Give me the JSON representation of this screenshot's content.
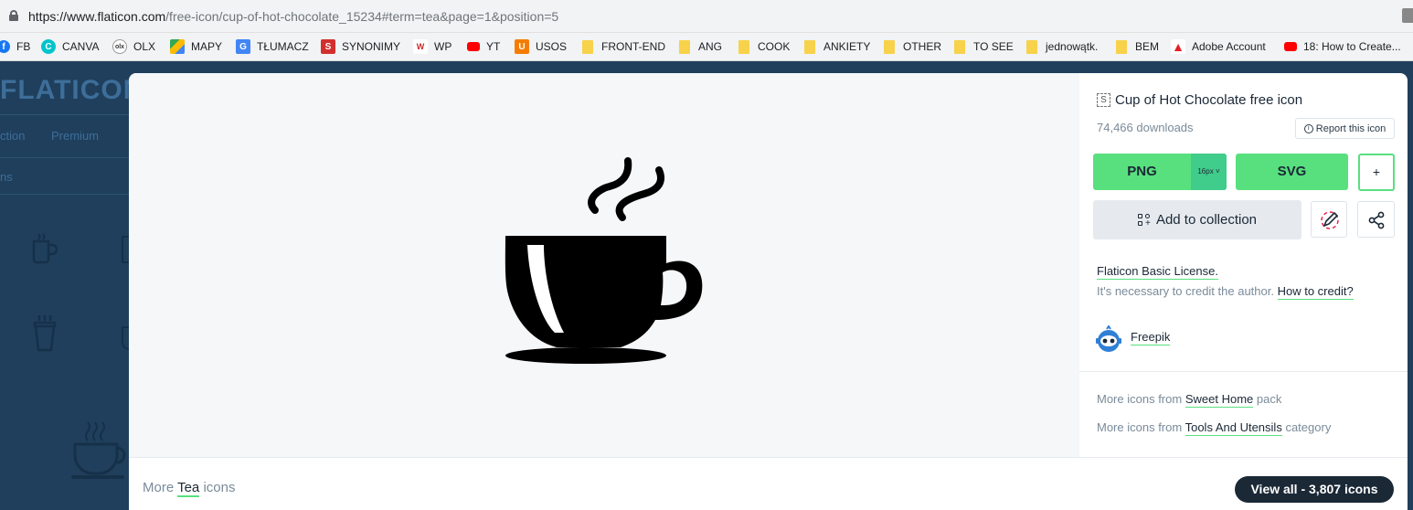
{
  "browser": {
    "url_host": "https://www.flaticon.com",
    "url_path": "/free-icon/cup-of-hot-chocolate_15234#term=tea&page=1&position=5",
    "bookmarks": [
      {
        "label": "FB",
        "icon": "facebook-icon"
      },
      {
        "label": "CANVA",
        "icon": "canva-icon"
      },
      {
        "label": "OLX",
        "icon": "olx-icon"
      },
      {
        "label": "MAPY",
        "icon": "maps-icon"
      },
      {
        "label": "TŁUMACZ",
        "icon": "translate-icon"
      },
      {
        "label": "SYNONIMY",
        "icon": "synonimy-icon"
      },
      {
        "label": "WP",
        "icon": "wp-icon"
      },
      {
        "label": "YT",
        "icon": "youtube-icon"
      },
      {
        "label": "USOS",
        "icon": "usos-icon"
      },
      {
        "label": "FRONT-END",
        "icon": "folder-icon"
      },
      {
        "label": "ANG",
        "icon": "folder-icon"
      },
      {
        "label": "COOK",
        "icon": "folder-icon"
      },
      {
        "label": "ANKIETY",
        "icon": "folder-icon"
      },
      {
        "label": "OTHER",
        "icon": "folder-icon"
      },
      {
        "label": "TO SEE",
        "icon": "folder-icon"
      },
      {
        "label": "jednowątk.",
        "icon": "folder-icon"
      },
      {
        "label": "BEM",
        "icon": "folder-icon"
      },
      {
        "label": "Adobe Account",
        "icon": "adobe-icon"
      },
      {
        "label": "18: How to Create...",
        "icon": "youtube-icon"
      }
    ]
  },
  "background": {
    "logo": "FLATICON",
    "line1": "ction",
    "line1b": "Premium",
    "line2": "ns"
  },
  "modal": {
    "icon_title": "Cup of Hot Chocolate free icon",
    "title_badge": "S",
    "downloads": "74,466 downloads",
    "report_label": "Report this icon",
    "png_label": "PNG",
    "png_size": "16px",
    "svg_label": "SVG",
    "plus_label": "+",
    "collection_label": "Add to collection",
    "license": "Flaticon Basic License.",
    "credit_text": "It's necessary to credit the author.",
    "credit_link": "How to credit?",
    "author": "Freepik",
    "more_pack_prefix": "More icons from",
    "more_pack_name": "Sweet Home",
    "more_pack_suffix": "pack",
    "more_cat_prefix": "More icons from",
    "more_cat_name": "Tools And Utensils",
    "more_cat_suffix": "category",
    "more_prefix": "More",
    "more_term": "Tea",
    "more_suffix": "icons",
    "view_all": "View all - 3,807 icons"
  },
  "colors": {
    "accent_green": "#58e07e",
    "dark_navy": "#1b2836",
    "overlay_blue": "#1f3f5c"
  }
}
